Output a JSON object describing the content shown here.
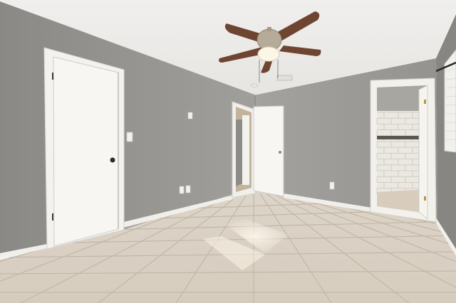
{
  "scene": {
    "description_free": true,
    "palette": {
      "ceiling": "#eeedeb",
      "wall_left": "#908f8c",
      "wall_back": "#9c9b97",
      "wall_right": "#878682",
      "trim": "#f4f3ef",
      "door": "#f6f5f1",
      "floor": "#dcd3c6",
      "floor_grout": "#c3b8a8",
      "fan_blade": "#6e4530",
      "fan_metal": "#b3a794",
      "subway_tile": "#ece9e3"
    }
  }
}
